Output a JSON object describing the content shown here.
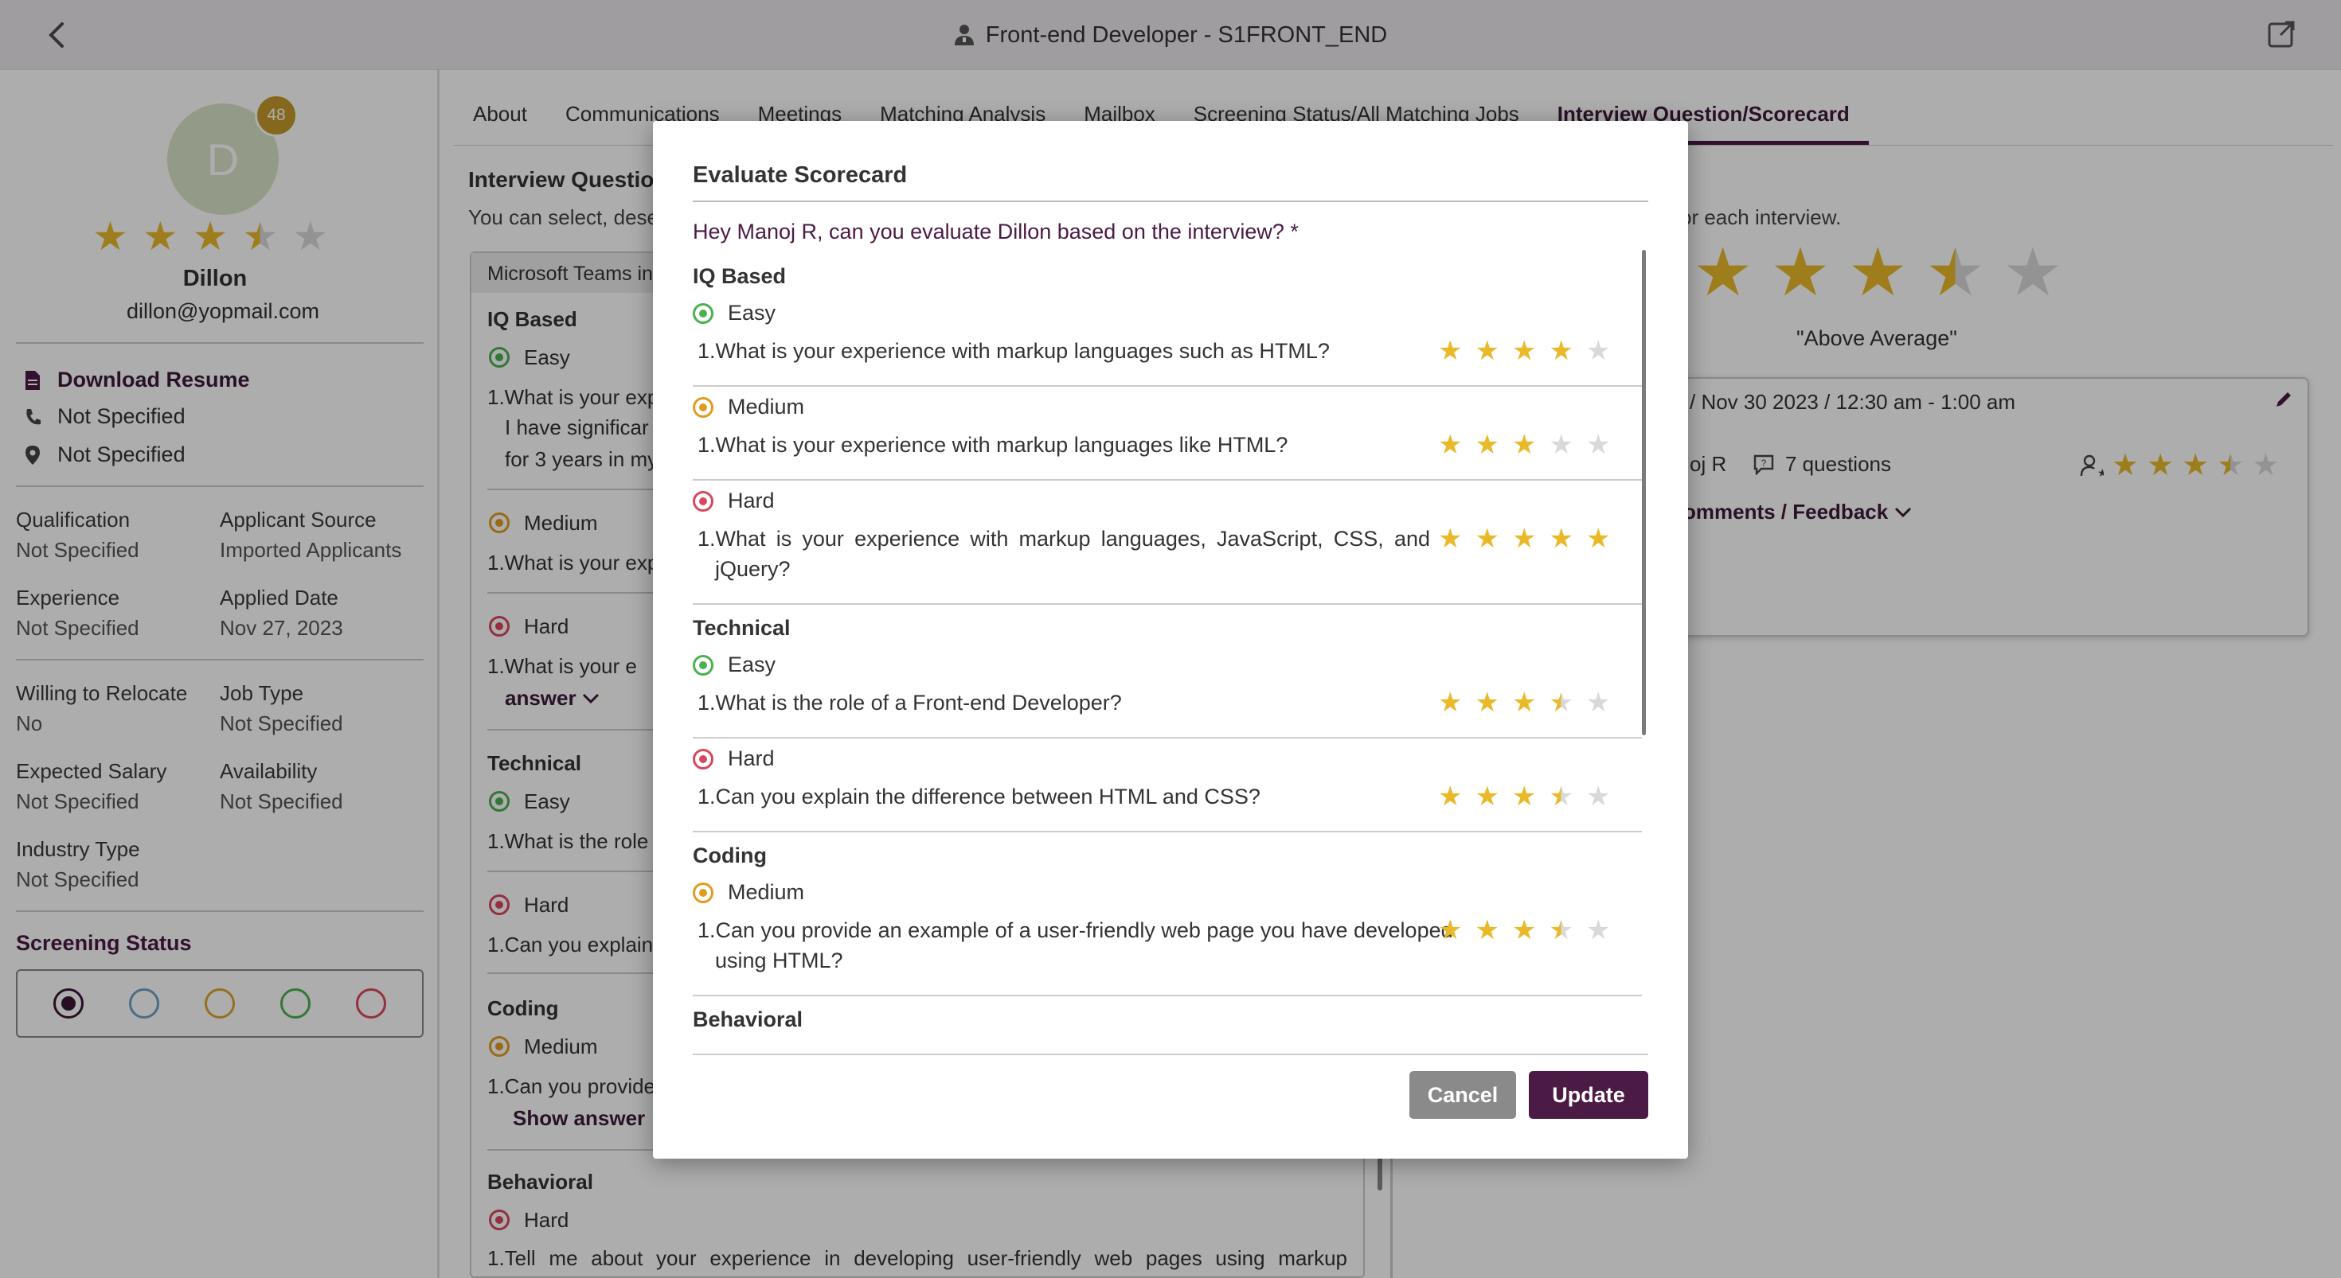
{
  "header": {
    "title": "Front-end Developer - S1FRONT_END",
    "back_icon": "chevron-left-icon",
    "external_icon": "external-link-icon"
  },
  "candidate": {
    "initial": "D",
    "badge": "48",
    "rating": 3.5,
    "name": "Dillon",
    "email": "dillon@yopmail.com",
    "download_resume": "Download Resume",
    "phone": "Not Specified",
    "location": "Not Specified",
    "fields": [
      {
        "label": "Qualification",
        "value": "Not Specified"
      },
      {
        "label": "Applicant Source",
        "value": "Imported Applicants"
      },
      {
        "label": "Experience",
        "value": "Not Specified"
      },
      {
        "label": "Applied Date",
        "value": "Nov 27, 2023"
      },
      {
        "label": "Willing to Relocate",
        "value": "No"
      },
      {
        "label": "Job Type",
        "value": "Not Specified"
      },
      {
        "label": "Expected Salary",
        "value": "Not Specified"
      },
      {
        "label": "Availability",
        "value": "Not Specified"
      },
      {
        "label": "Industry Type",
        "value": "Not Specified"
      }
    ],
    "screening_title": "Screening Status",
    "screening_colors": [
      "#3c1536",
      "#6aa0c8",
      "#d9a72a",
      "#4caf50",
      "#d9475c"
    ]
  },
  "tabs": [
    "About",
    "Communications",
    "Meetings",
    "Matching Analysis",
    "Mailbox",
    "Screening Status/All Matching Jobs",
    "Interview Question/Scorecard"
  ],
  "background": {
    "heading": "Interview Questio",
    "subtext": "You can select, dese",
    "panel_head": "Microsoft Teams in",
    "iq": "IQ Based",
    "easy": "Easy",
    "medium": "Medium",
    "hard": "Hard",
    "q_exp_partial": "1.What is your exp",
    "ans_line1": "I have significar",
    "ans_line2": "for 3 years in my",
    "q_exp_partial2": "1.What is your exp",
    "q_hard_partial": "1.What is your e",
    "answer_link": "answer",
    "technical": "Technical",
    "q_role_partial": "1.What is the role",
    "q_explain_partial": "1.Can you explain",
    "coding": "Coding",
    "q_provide_partial": "1.Can you provide",
    "show_answer": "Show answer",
    "behavioral": "Behavioral",
    "q_behavioral": "1.Tell me about your experience in developing user-friendly web pages using markup",
    "right_sub": "or each interview.",
    "overall_rating": 3.5,
    "above_avg": "\"Above Average\"",
    "meeting_date": "/ Nov 30 2023 / 12:30 am - 1:00 am",
    "meeting_who": "oj R",
    "meeting_questions": "7 questions",
    "meeting_rating": 3.5,
    "comments": "omments / Feedback"
  },
  "modal": {
    "title": "Evaluate Scorecard",
    "prompt": "Hey Manoj R, can you evaluate Dillon based on the interview? *",
    "sections": [
      {
        "category": "IQ Based",
        "items": [
          {
            "level": "Easy",
            "question": "1.What is your experience with markup languages such as HTML?",
            "rating": 4
          },
          {
            "level": "Medium",
            "question": "1.What is your experience with markup languages like HTML?",
            "rating": 3
          },
          {
            "level": "Hard",
            "question_l1": "1.What is your experience with markup languages, JavaScript, CSS, and",
            "question_l2": "jQuery?",
            "rating": 5
          }
        ]
      },
      {
        "category": "Technical",
        "items": [
          {
            "level": "Easy",
            "question": "1.What is the role of a Front-end Developer?",
            "rating": 3.5
          },
          {
            "level": "Hard",
            "question": "1.Can you explain the difference between HTML and CSS?",
            "rating": 3.5
          }
        ]
      },
      {
        "category": "Coding",
        "items": [
          {
            "level": "Medium",
            "question_l1": "1.Can you provide an example of a user-friendly web page you have developed",
            "question_l2": "using HTML?",
            "rating": 3.5
          }
        ]
      },
      {
        "category": "Behavioral",
        "items": []
      }
    ],
    "cancel": "Cancel",
    "update": "Update"
  }
}
